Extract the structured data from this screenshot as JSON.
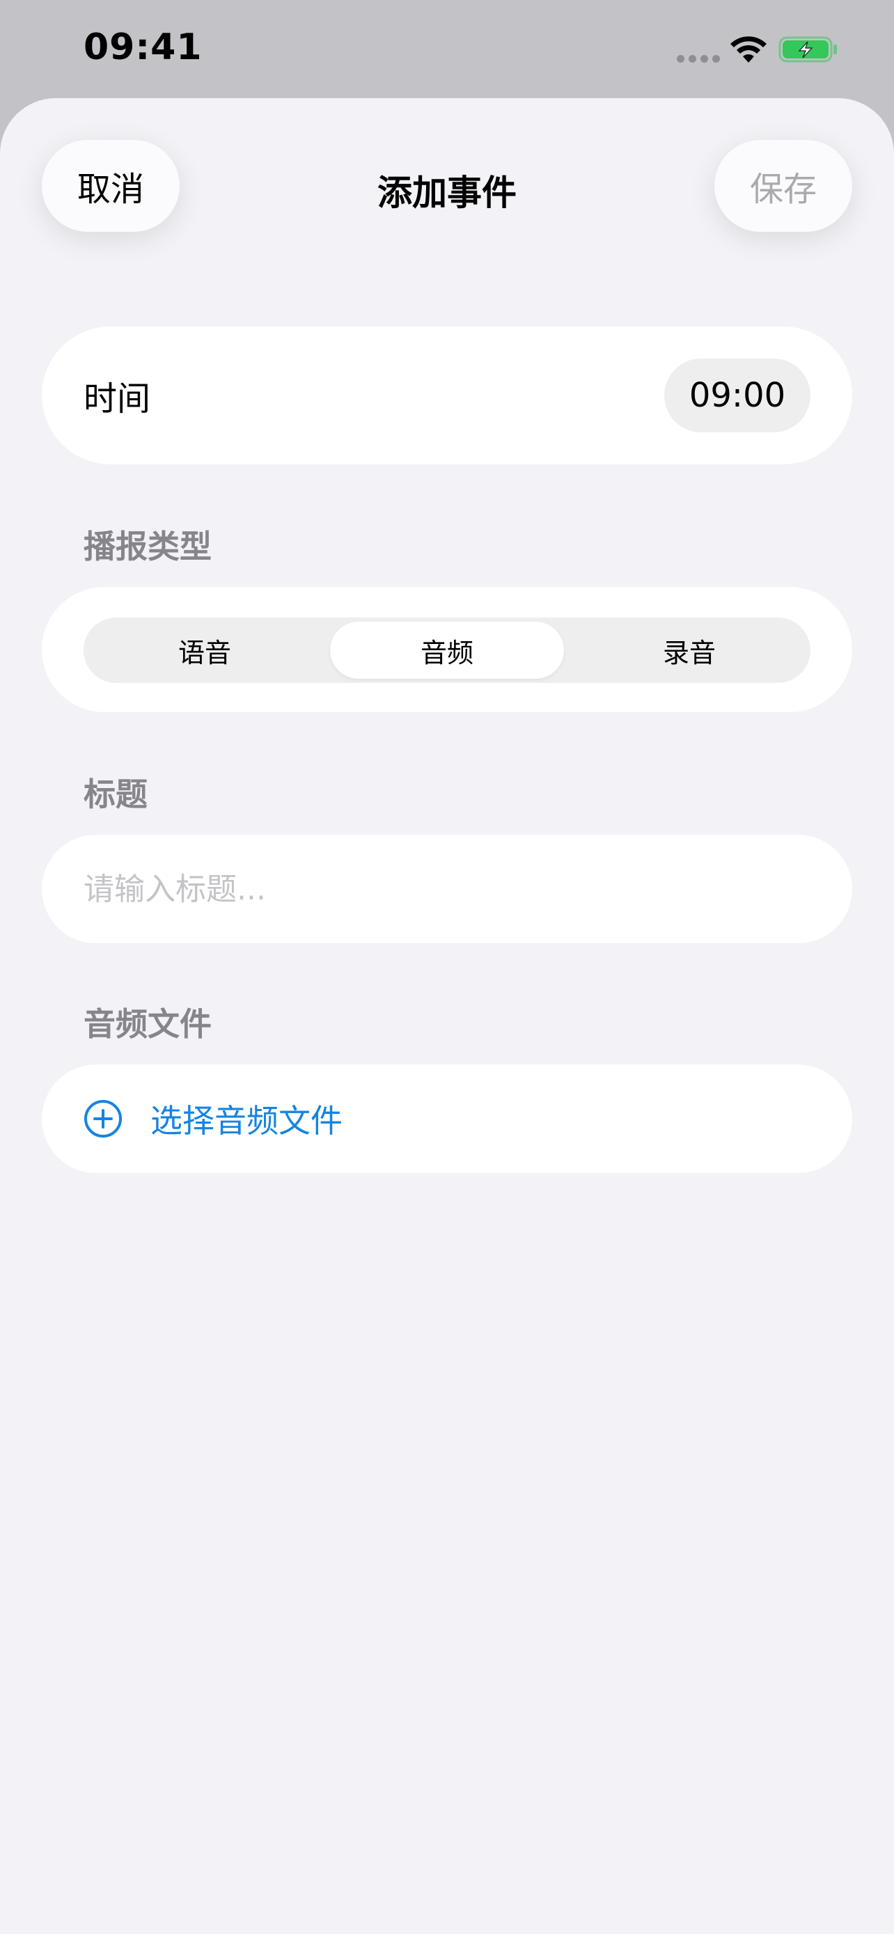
{
  "status_bar": {
    "time": "09:41"
  },
  "sheet": {
    "title": "添加事件",
    "cancel_label": "取消",
    "save_label": "保存"
  },
  "time_row": {
    "label": "时间",
    "value": "09:00"
  },
  "broadcast_type": {
    "section_label": "播报类型",
    "segments": [
      "语音",
      "音频",
      "录音"
    ],
    "selected_index": 1
  },
  "title_field": {
    "section_label": "标题",
    "value": "",
    "placeholder": "请输入标题..."
  },
  "audio_file": {
    "section_label": "音频文件",
    "button_label": "选择音频文件",
    "icon": "plus-circle-icon"
  },
  "colors": {
    "accent": "#1584e1",
    "sheet_background": "#f2f2f7",
    "card_background": "#ffffff",
    "disabled_text": "#a9a9ae",
    "section_label": "#85858b",
    "battery_fill": "#34c759"
  }
}
